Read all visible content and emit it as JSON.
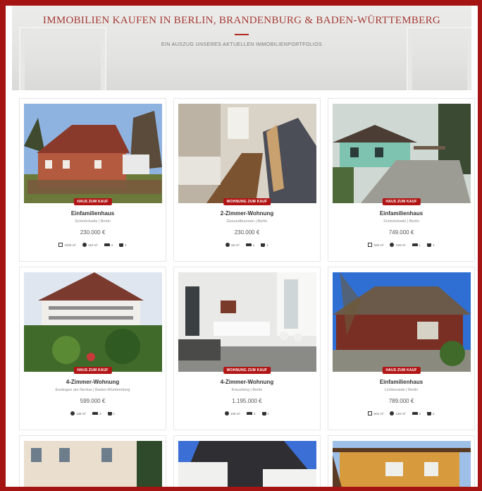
{
  "hero": {
    "title": "IMMOBILIEN KAUFEN IN BERLIN, BRANDENBURG & BADEN-WÜRTTEMBERG",
    "subtitle": "EIN AUSZUG UNSERES AKTUELLEN IMMOBILIENPORTFOLIOS"
  },
  "listings": [
    {
      "badge": "HAUS ZUM KAUF",
      "title": "Einfamilienhaus",
      "location": "Schmöckwitz | Berlin",
      "price": "230.000 €",
      "features": [
        {
          "icon": "area-icon",
          "value": "1000 m²"
        },
        {
          "icon": "globe-icon",
          "value": "110 m²"
        },
        {
          "icon": "bed-icon",
          "value": "3"
        },
        {
          "icon": "bath-icon",
          "value": "2"
        }
      ]
    },
    {
      "badge": "WOHNUNG ZUM KAUF",
      "title": "2-Zimmer-Wohnung",
      "location": "Gesundbrunnen | Berlin",
      "price": "230.000 €",
      "features": [
        {
          "icon": "globe-icon",
          "value": "55 m²"
        },
        {
          "icon": "bed-icon",
          "value": "1"
        },
        {
          "icon": "bath-icon",
          "value": "1"
        }
      ]
    },
    {
      "badge": "HAUS ZUM KAUF",
      "title": "Einfamilienhaus",
      "location": "Schmöckwitz | Berlin",
      "price": "749.000 €",
      "features": [
        {
          "icon": "area-icon",
          "value": "526 m²"
        },
        {
          "icon": "globe-icon",
          "value": "109 m²"
        },
        {
          "icon": "bed-icon",
          "value": "1"
        },
        {
          "icon": "bath-icon",
          "value": "1"
        }
      ]
    },
    {
      "badge": "HAUS ZUM KAUF",
      "title": "4-Zimmer-Wohnung",
      "location": "Esslingen am Neckar | Baden-Württemberg",
      "price": "599.000 €",
      "features": [
        {
          "icon": "globe-icon",
          "value": "138 m²"
        },
        {
          "icon": "bed-icon",
          "value": "3"
        },
        {
          "icon": "bath-icon",
          "value": "1"
        }
      ]
    },
    {
      "badge": "WOHNUNG ZUM KAUF",
      "title": "4-Zimmer-Wohnung",
      "location": "Kreuzberg | Berlin",
      "price": "1.195.000 €",
      "features": [
        {
          "icon": "globe-icon",
          "value": "105 m²"
        },
        {
          "icon": "bed-icon",
          "value": "3"
        },
        {
          "icon": "bath-icon",
          "value": "1"
        }
      ]
    },
    {
      "badge": "HAUS ZUM KAUF",
      "title": "Einfamilienhaus",
      "location": "Lichtenrade | Berlin",
      "price": "789.000 €",
      "features": [
        {
          "icon": "area-icon",
          "value": "602 m²"
        },
        {
          "icon": "globe-icon",
          "value": "130 m²"
        },
        {
          "icon": "bed-icon",
          "value": "3"
        },
        {
          "icon": "bath-icon",
          "value": "2"
        }
      ]
    }
  ]
}
